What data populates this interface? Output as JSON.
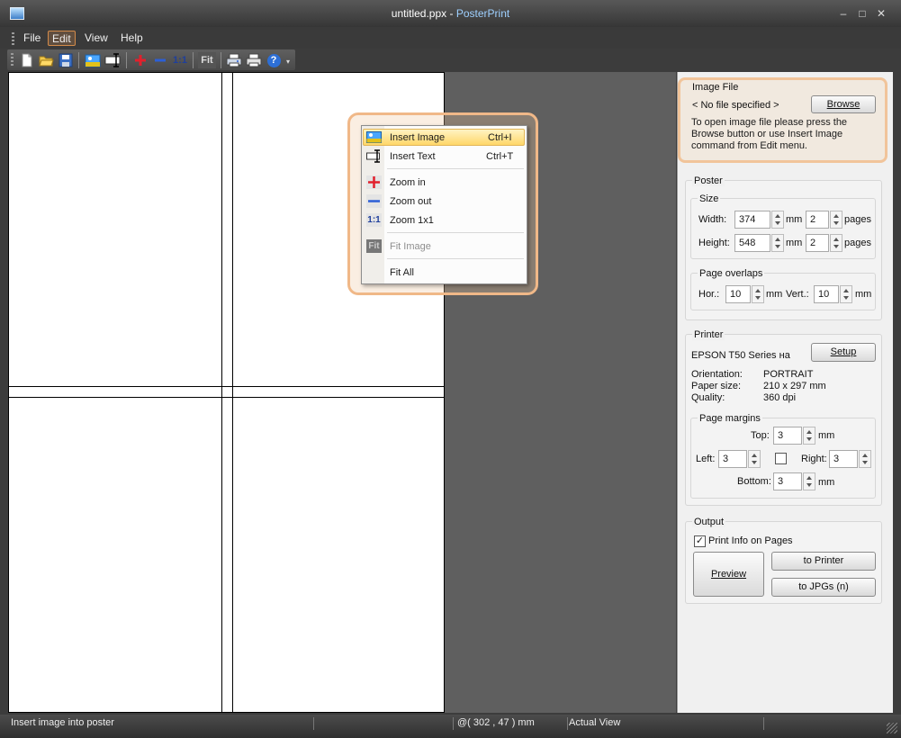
{
  "window": {
    "title_file": "untitled.ppx",
    "title_sep": " - ",
    "title_app": "PosterPrint",
    "minimize": "–",
    "maximize": "□",
    "close": "✕"
  },
  "menubar": {
    "file": "File",
    "edit": "Edit",
    "view": "View",
    "help": "Help"
  },
  "toolbar": {
    "icons": [
      "new-icon",
      "open-icon",
      "save-icon",
      "insert-image-icon",
      "insert-text-icon",
      "zoom-in-icon",
      "zoom-out-icon",
      "zoom-1x1-icon",
      "fit-icon",
      "print-setup-icon",
      "print-icon",
      "help-icon"
    ],
    "zoom_1x1": "1:1",
    "fit": "Fit",
    "help": "?"
  },
  "context_menu": {
    "items": [
      {
        "label": "Insert Image",
        "shortcut": "Ctrl+I",
        "icon": "insert-image-icon",
        "highlighted": true
      },
      {
        "label": "Insert Text",
        "shortcut": "Ctrl+T",
        "icon": "insert-text-icon"
      },
      {
        "label": "Zoom in",
        "icon": "zoom-in-icon"
      },
      {
        "label": "Zoom out",
        "icon": "zoom-out-icon"
      },
      {
        "label": "Zoom 1x1",
        "icon": "zoom-1x1-icon",
        "icon_text": "1:1"
      },
      {
        "label": "Fit Image",
        "icon": "fit-image-icon",
        "icon_text": "Fit",
        "disabled": true
      },
      {
        "label": "Fit All"
      }
    ]
  },
  "image_file": {
    "title": "Image File",
    "no_file": "< No file specified >",
    "browse": "Browse",
    "hint": "To open image file please press the Browse button or use Insert Image command from Edit menu."
  },
  "poster": {
    "title": "Poster",
    "size_title": "Size",
    "width_label": "Width:",
    "width_value": "374",
    "width_unit": "mm",
    "width_pages": "2",
    "pages_label": "pages",
    "height_label": "Height:",
    "height_value": "548",
    "height_unit": "mm",
    "height_pages": "2",
    "overlaps_title": "Page overlaps",
    "hor_label": "Hor.:",
    "hor_value": "10",
    "vert_label": "Vert.:",
    "vert_value": "10",
    "mm": "mm"
  },
  "printer": {
    "title": "Printer",
    "name": "EPSON T50 Series на",
    "setup": "Setup",
    "orientation_label": "Orientation:",
    "orientation_value": "PORTRAIT",
    "paper_label": "Paper size:",
    "paper_value": "210 x 297 mm",
    "quality_label": "Quality:",
    "quality_value": "360 dpi",
    "margins_title": "Page margins",
    "top_label": "Top:",
    "top_value": "3",
    "left_label": "Left:",
    "left_value": "3",
    "right_label": "Right:",
    "right_value": "3",
    "bottom_label": "Bottom:",
    "bottom_value": "3",
    "mm": "mm",
    "link_checked": false
  },
  "output": {
    "title": "Output",
    "print_info": "Print Info on Pages",
    "print_info_checked": true,
    "preview": "Preview",
    "to_printer": "to Printer",
    "to_jpgs": "to JPGs (n)"
  },
  "status": {
    "message": "Insert image into poster",
    "coords": "@( 302 , 47 ) mm",
    "view": "Actual View"
  }
}
